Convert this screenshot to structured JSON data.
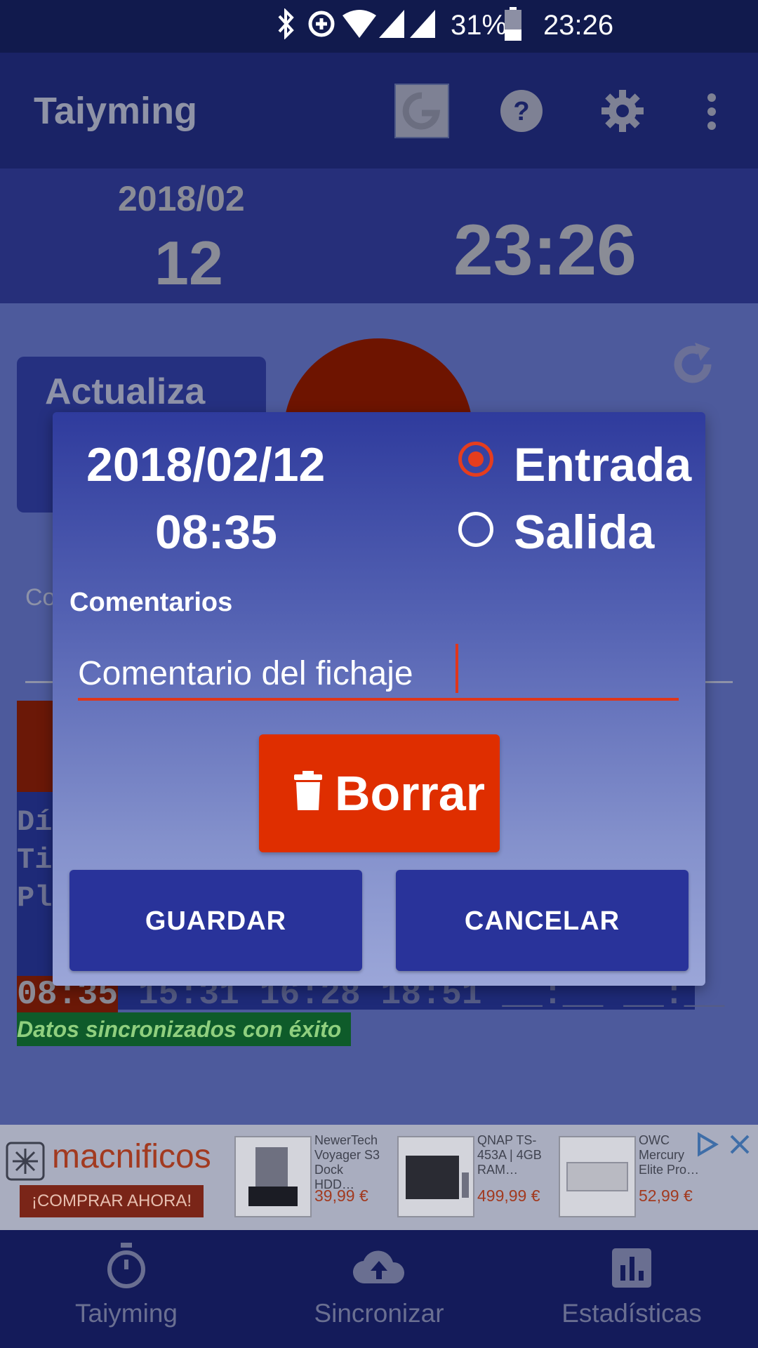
{
  "status_bar": {
    "battery": "31%",
    "time": "23:26"
  },
  "app_bar": {
    "title": "Taiyming"
  },
  "header": {
    "year_month": "2018/02",
    "day": "12",
    "time": "23:26"
  },
  "background": {
    "update_button_label": "Actualiza",
    "comments_label_partial": "Co",
    "times_row": [
      "08:35",
      "15:31",
      "16:28",
      "18:51",
      "__:__",
      "__:__"
    ],
    "row_letters": [
      "Dí",
      "Ti",
      "Pl"
    ],
    "sync_message": "Datos sincronizados con éxito"
  },
  "ad": {
    "brand": "macnificos",
    "cta": "¡COMPRAR AHORA!",
    "products": [
      {
        "name": "NewerTech Voyager S3 Dock HDD…",
        "price": "39,99 €"
      },
      {
        "name": "QNAP TS-453A | 4GB RAM…",
        "price": "499,99 €"
      },
      {
        "name": "OWC Mercury Elite Pro…",
        "price": "52,99 €"
      }
    ]
  },
  "bottom_nav": {
    "items": [
      {
        "label": "Taiyming",
        "icon": "stopwatch-icon"
      },
      {
        "label": "Sincronizar",
        "icon": "cloud-upload-icon"
      },
      {
        "label": "Estadísticas",
        "icon": "bar-chart-icon"
      }
    ]
  },
  "dialog": {
    "date": "2018/02/12",
    "time": "08:35",
    "radio_entrada": "Entrada",
    "radio_salida": "Salida",
    "selected": "Entrada",
    "comments_label": "Comentarios",
    "comment_value": "Comentario del fichaje",
    "delete_label": "Borrar",
    "save_label": "GUARDAR",
    "cancel_label": "CANCELAR"
  },
  "colors": {
    "accent": "#df2e00",
    "primary": "#29339a",
    "dark": "#141b5a"
  }
}
